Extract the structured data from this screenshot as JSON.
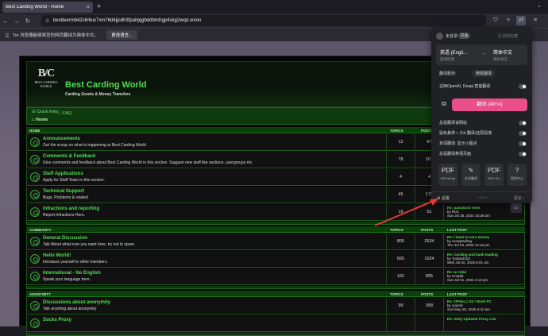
{
  "browser": {
    "tab_title": "Best Carding World - Home",
    "tab_close": "×",
    "new_tab": "+",
    "tab_list": "⌄",
    "url": "bestteermb42clir6ux7xm76d4jjodh3fpahjqgbddbmfrgp4skg2wqd.onion",
    "nav": {
      "back": "←",
      "forward": "→",
      "reload": "↻"
    },
    "toolbar_icons": [
      "shield-icon",
      "translate-icon",
      "extension-icon",
      "menu-icon"
    ]
  },
  "notification": {
    "text": "Tor 浏览器能够将您的网页翻译为简体中文。",
    "button": "更改语言..."
  },
  "forum": {
    "logo_mono": "B/C",
    "logo_name": "BEST CARDING WORLD",
    "site_title": "Best Carding World",
    "site_sub": "Carding Goods & Money Transfers",
    "quick_links": "Quick links",
    "faq": "FAQ",
    "home_crumb": "Home",
    "categories": [
      {
        "name": "HOME",
        "col_topics": "TOPICS",
        "col_posts": "POSTS",
        "col_last": "",
        "forums": [
          {
            "title": "Announcements",
            "desc": "Get the scoop on what is happening at Best Carding World",
            "topics": "12",
            "posts": "67",
            "lp_title": "",
            "lp_by": "",
            "lp_date": ""
          },
          {
            "title": "Comments & Feedback",
            "desc": "Give comments and feedback about Best Carding World in this section. Suggest new stuff like sections, usergroups etc.",
            "topics": "78",
            "posts": "167",
            "lp_title": "",
            "lp_by": "",
            "lp_date": ""
          },
          {
            "title": "Staff Applications",
            "desc": "Apply for Staff Team in this section.",
            "topics": "4",
            "posts": "4",
            "lp_title": "",
            "lp_by": "",
            "lp_date": ""
          },
          {
            "title": "Technical Support",
            "desc": "Bugs, Problems & related",
            "topics": "45",
            "posts": "178",
            "lp_title": "",
            "lp_by": "",
            "lp_date": ""
          },
          {
            "title": "Infractions and reporting",
            "desc": "Report Infractions Here.",
            "topics": "19",
            "posts": "51",
            "lp_title": "Re: password reset",
            "lp_by": "Rizz",
            "lp_date": "Sun Jul 28, 2024 10:38 am"
          }
        ]
      },
      {
        "name": "COMMUNITY",
        "col_topics": "TOPICS",
        "col_posts": "POSTS",
        "col_last": "LAST POST",
        "forums": [
          {
            "title": "General Discussion",
            "desc": "Talk About what ever you want here, try not to spam.",
            "topics": "805",
            "posts": "2534",
            "lp_title": "Re: I want to earn money",
            "lp_by": "exceptaxling",
            "lp_date": "Thu Jul 03, 2025 12:16 pm"
          },
          {
            "title": "Hello World!",
            "desc": "Introduce yourself to other members.",
            "topics": "565",
            "posts": "1024",
            "lp_title": "Re: Carding and bank loading",
            "lp_by": "Toolsed102",
            "lp_date": "Wed Jul 02, 2025 6:01 am"
          },
          {
            "title": "International - No English",
            "desc": "Speak your language here.",
            "topics": "162",
            "posts": "895",
            "lp_title": "Re: ur Adul",
            "lp_by": "Hmadit",
            "lp_date": "Sun Jul 01, 2025 3:13 pm"
          }
        ]
      },
      {
        "name": "ANONYMITY",
        "col_topics": "TOPICS",
        "col_posts": "POSTS",
        "col_last": "LAST POST",
        "forums": [
          {
            "title": "Discussions about anonymity",
            "desc": "Talk anything about anonymity",
            "topics": "99",
            "posts": "308",
            "lp_title": "Re: OPSec | OS / Work PC",
            "lp_by": "cpumd",
            "lp_date": "Sun May 25, 2025 4:42 am"
          },
          {
            "title": "Socks Proxy",
            "desc": "",
            "topics": "",
            "posts": "",
            "lp_title": "Re: Daily Updated Proxy List",
            "lp_by": "",
            "lp_date": ""
          }
        ]
      }
    ]
  },
  "popup": {
    "login": "未登录",
    "vip": "开通",
    "general": "生词和收藏",
    "src_lang": "英语 (Engli...",
    "src_sub": "自动检测",
    "tgt_lang": "简体中文",
    "tgt_sub": "目标语言",
    "arrow": "→",
    "service_label": "翻译服务:",
    "service_value": "微软翻译",
    "openai_label": "试用OpenAI, DeepL智能翻译",
    "translate_btn": "翻译 (Alt+A)",
    "opt1": "总是翻译该网站",
    "opt2": "鼠标悬停 + Ctrl 翻译/还原段落",
    "opt3": "划词翻译: 显示小图点",
    "opt4": "总是翻译英语页面",
    "tools": [
      {
        "icon": "PDF",
        "label": "PDF/ePub"
      },
      {
        "icon": "✎",
        "label": "文本翻译"
      },
      {
        "icon": "PDF",
        "label": "PDF Pro"
      },
      {
        "icon": "?",
        "label": "帮助中心"
      }
    ],
    "settings": "设置",
    "version": "1.18.1",
    "more": "更多 ›"
  },
  "colors": {
    "accent_green": "#4fe04f",
    "translate_pink": "#e94f8a",
    "arrow_red": "#e53935"
  },
  "side_float_icon": "chat-icon"
}
